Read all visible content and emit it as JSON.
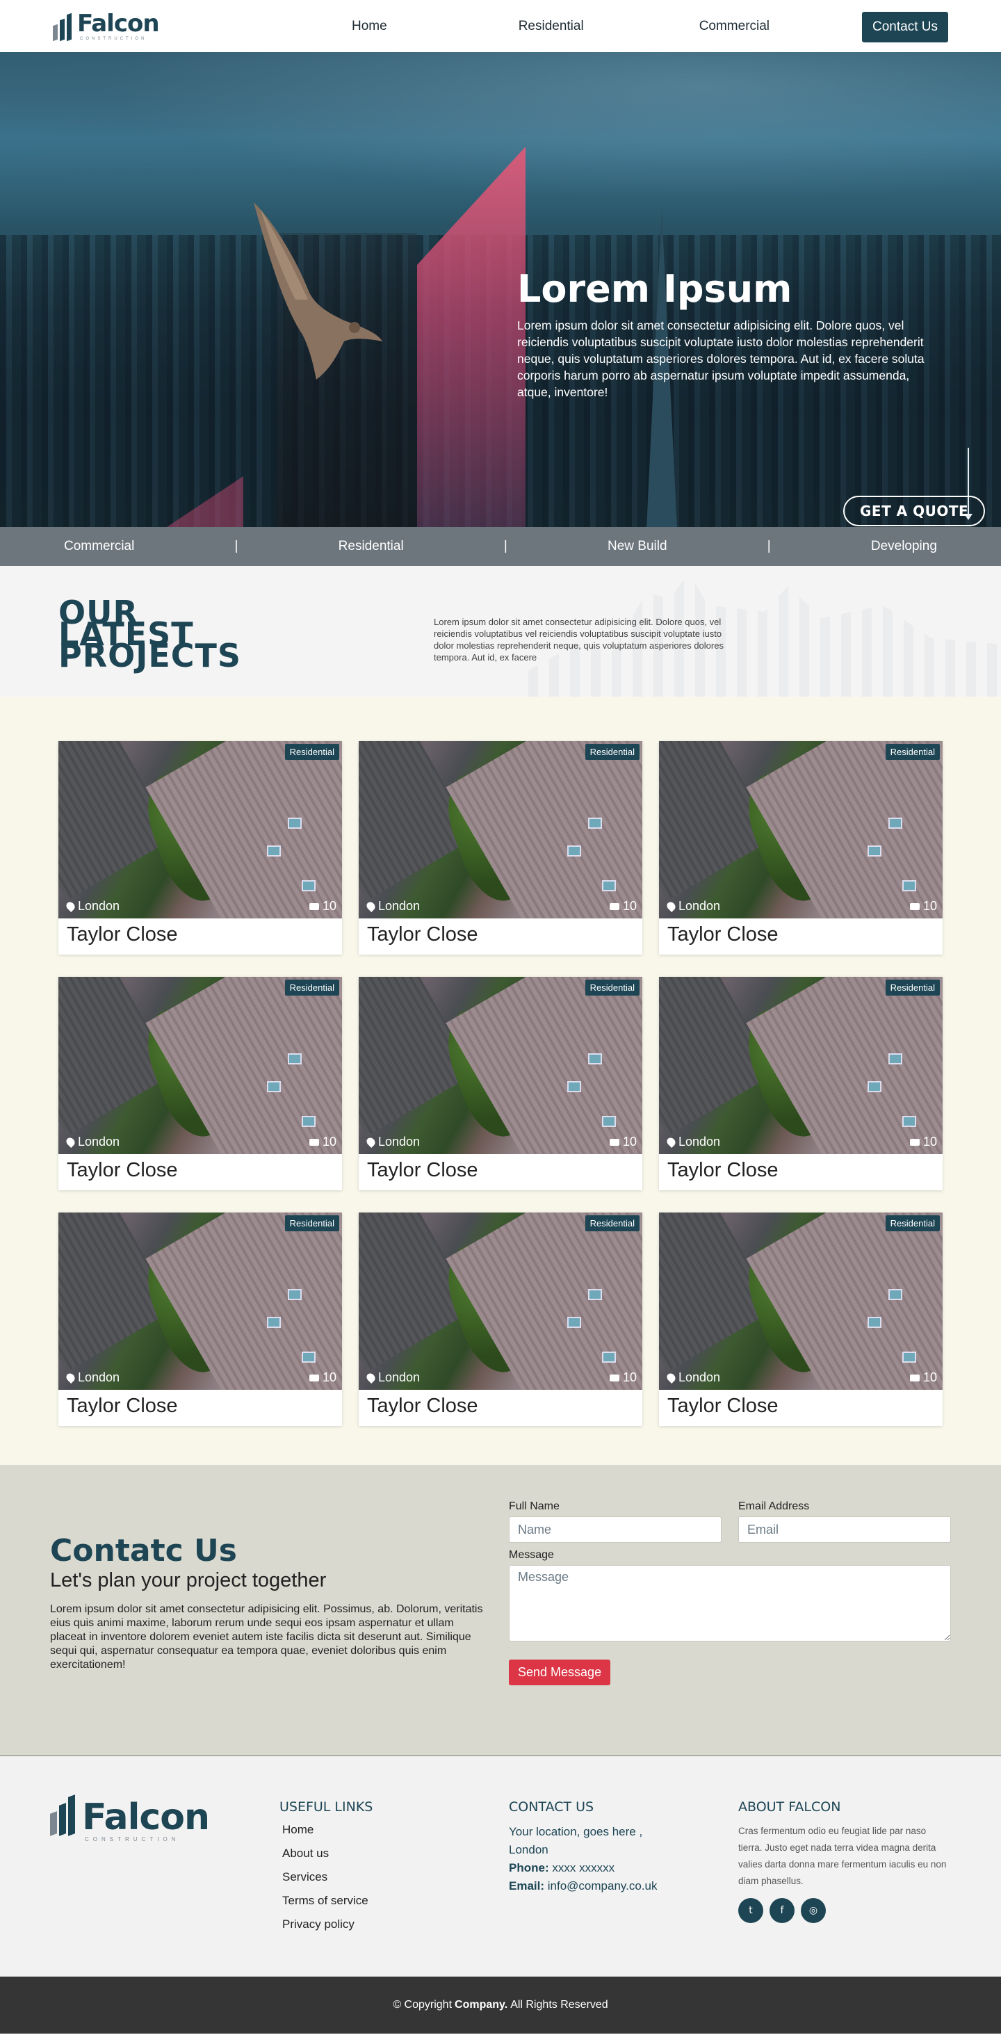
{
  "nav": {
    "logo_name": "Falcon",
    "logo_sub": "CONSTRUCTION",
    "links": [
      "Home",
      "Residential",
      "Commercial"
    ],
    "contact_label": "Contact Us"
  },
  "hero": {
    "title": "Lorem Ipsum",
    "text": "Lorem ipsum dolor sit amet consectetur adipisicing elit. Dolore quos, vel reiciendis voluptatibus suscipit voluptate iusto dolor molestias reprehenderit neque, quis voluptatum asperiores dolores tempora. Aut id, ex facere soluta corporis harum porro ab aspernatur ipsum voluptate impedit assumenda, atque, inventore!",
    "quote_label": "GET A QUOTE"
  },
  "categories": [
    "Commercial",
    "Residential",
    "New Build",
    "Developing"
  ],
  "category_separator": "|",
  "latest": {
    "title_lines": [
      "OUR",
      "LATEST",
      "PROJECTS"
    ],
    "text": "Lorem ipsum dolor sit amet consectetur adipisicing elit. Dolore quos, vel reiciendis voluptatibus vel reiciendis voluptatibus suscipit voluptate iusto dolor molestias reprehenderit neque, quis voluptatum asperiores dolores tempora. Aut id, ex facere"
  },
  "projects": [
    {
      "badge": "Residential",
      "location": "London",
      "count": "10",
      "title": "Taylor Close"
    },
    {
      "badge": "Residential",
      "location": "London",
      "count": "10",
      "title": "Taylor Close"
    },
    {
      "badge": "Residential",
      "location": "London",
      "count": "10",
      "title": "Taylor Close"
    },
    {
      "badge": "Residential",
      "location": "London",
      "count": "10",
      "title": "Taylor Close"
    },
    {
      "badge": "Residential",
      "location": "London",
      "count": "10",
      "title": "Taylor Close"
    },
    {
      "badge": "Residential",
      "location": "London",
      "count": "10",
      "title": "Taylor Close"
    },
    {
      "badge": "Residential",
      "location": "London",
      "count": "10",
      "title": "Taylor Close"
    },
    {
      "badge": "Residential",
      "location": "London",
      "count": "10",
      "title": "Taylor Close"
    },
    {
      "badge": "Residential",
      "location": "London",
      "count": "10",
      "title": "Taylor Close"
    }
  ],
  "contact": {
    "title": "Contatc Us",
    "subtitle": "Let's plan your project together",
    "text": "Lorem ipsum dolor sit amet consectetur adipisicing elit. Possimus, ab. Dolorum, veritatis eius quis animi maxime, laborum rerum unde sequi eos ipsam aspernatur et ullam placeat in inventore dolorem eveniet autem iste facilis dicta sit deserunt aut. Similique sequi qui, aspernatur consequatur ea tempora quae, eveniet doloribus quis enim exercitationem!",
    "name_label": "Full Name",
    "name_placeholder": "Name",
    "email_label": "Email Address",
    "email_placeholder": "Email",
    "message_label": "Message",
    "message_placeholder": "Message",
    "send_label": "Send Message"
  },
  "footer": {
    "links_title": "USEFUL LINKS",
    "links": [
      "Home",
      "About us",
      "Services",
      "Terms of service",
      "Privacy policy"
    ],
    "contact_title": "CONTACT US",
    "location": "Your location, goes here , London",
    "phone_label": "Phone:",
    "phone": "xxxx xxxxxx",
    "email_label": "Email:",
    "email": "info@company.co.uk",
    "about_title": "ABOUT FALCON",
    "about_text": "Cras fermentum odio eu feugiat lide par naso tierra. Justo eget nada terra videa magna derita valies darta donna mare fermentum iaculis eu non diam phasellus.",
    "social_icons": [
      "twitter-icon",
      "facebook-icon",
      "instagram-icon"
    ]
  },
  "copyright": {
    "prefix": "© Copyright",
    "company": "Company.",
    "suffix": "All Rights Reserved"
  },
  "colors": {
    "brand": "#1d4554",
    "accent_red": "#dc3545",
    "category_bar": "#6d757d",
    "projects_bg": "#f8f7ea",
    "contact_bg": "#d9d9cf"
  }
}
